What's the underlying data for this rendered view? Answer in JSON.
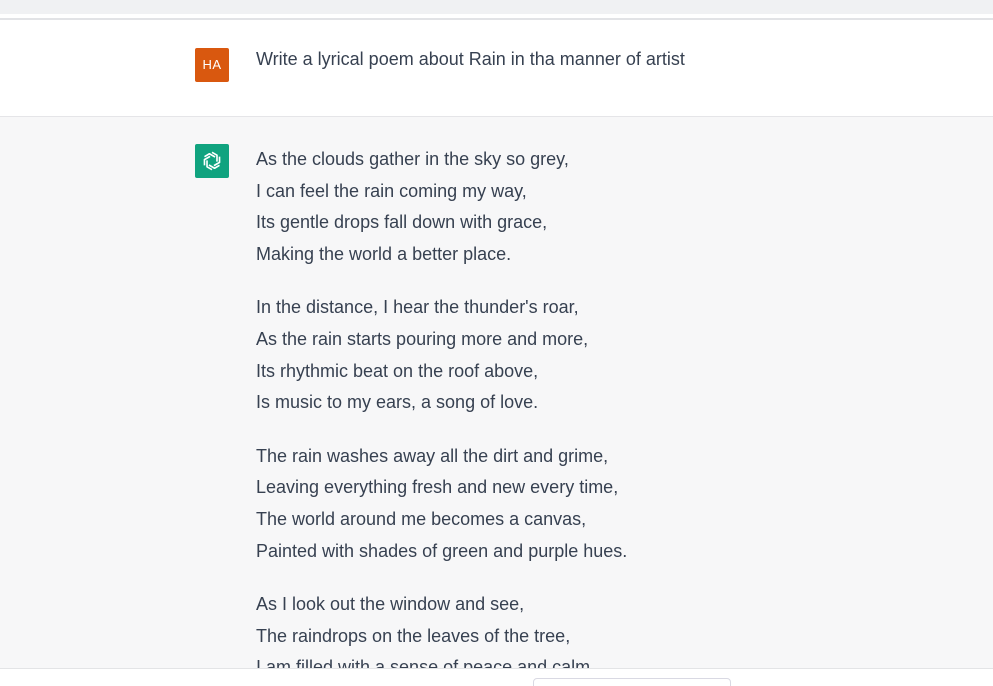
{
  "user_message": {
    "avatar_initials": "HA",
    "avatar_color": "#d9580f",
    "text": "Write a lyrical poem about Rain in tha manner of artist"
  },
  "assistant_message": {
    "avatar_icon": "openai-logo-icon",
    "avatar_color": "#10a37f",
    "stanzas": [
      {
        "lines": [
          "As the clouds gather in the sky so grey,",
          "I can feel the rain coming my way,",
          "Its gentle drops fall down with grace,",
          "Making the world a better place."
        ]
      },
      {
        "lines": [
          "In the distance, I hear the thunder's roar,",
          "As the rain starts pouring more and more,",
          "Its rhythmic beat on the roof above,",
          "Is music to my ears, a song of love."
        ]
      },
      {
        "lines": [
          "The rain washes away all the dirt and grime,",
          "Leaving everything fresh and new every time,",
          "The world around me becomes a canvas,",
          "Painted with shades of green and purple hues."
        ]
      },
      {
        "lines": [
          "As I look out the window and see,",
          "The raindrops on the leaves of the tree,",
          "I am filled with a sense of peace and calm,"
        ]
      }
    ]
  }
}
